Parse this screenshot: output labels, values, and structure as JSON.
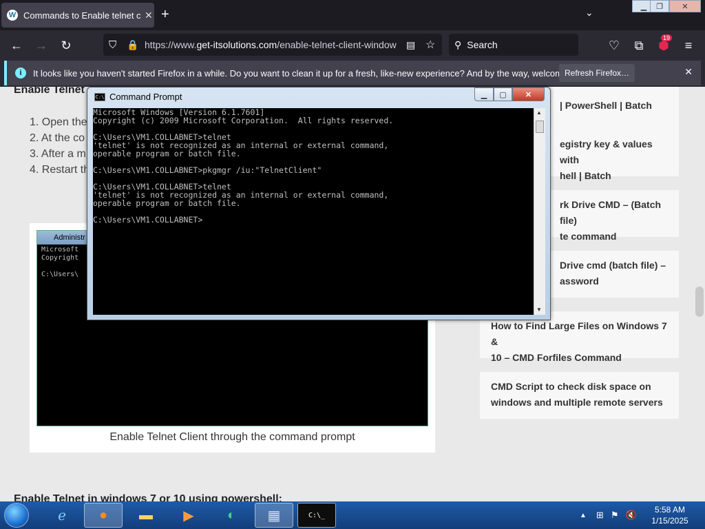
{
  "browser": {
    "tab": {
      "title": "Commands to Enable telnet cli",
      "favicon": "wordpress-icon"
    },
    "url": {
      "prefix": "https://www.",
      "domain": "get-itsolutions.com",
      "path": "/enable-telnet-client-window"
    },
    "search_placeholder": "Search",
    "extensions_badge": "19"
  },
  "notification": {
    "text": "It looks like you haven't started Firefox in a while. Do you want to clean it up for a fresh, like-new experience? And by the way, welcome back!",
    "button": "Refresh Firefox…"
  },
  "page": {
    "heading": "Enable Telnet",
    "steps": [
      "1. Open the",
      "2. At the co",
      "3. After a m",
      "4. Restart th"
    ],
    "figure": {
      "inner_title": "Administr",
      "inner_lines": [
        "Microsoft",
        "Copyright",
        "",
        "C:\\Users\\"
      ],
      "caption": "Enable Telnet Client through the command prompt"
    },
    "bottom_heading": "Enable Telnet in windows 7 or 10 using powershell:",
    "sidebar": [
      {
        "line1": "| PowerShell | Batch",
        "line2": ""
      },
      {
        "line1": "egistry key & values with",
        "line2": "hell | Batch"
      },
      {
        "line1": "rk Drive CMD – (Batch file)",
        "line2": "te command"
      },
      {
        "line1": "Drive cmd (batch file) –",
        "line2": "assword"
      },
      {
        "line1": "How to Find Large Files on Windows 7 &",
        "line2": "10 – CMD Forfiles Command"
      },
      {
        "line1": "CMD Script to check disk space on",
        "line2": "windows and multiple remote servers"
      }
    ]
  },
  "cmd": {
    "title": "Command Prompt",
    "output": "Microsoft Windows [Version 6.1.7601]\nCopyright (c) 2009 Microsoft Corporation.  All rights reserved.\n\nC:\\Users\\VM1.COLLABNET>telnet\n'telnet' is not recognized as an internal or external command,\noperable program or batch file.\n\nC:\\Users\\VM1.COLLABNET>pkgmgr /iu:\"TelnetClient\"\n\nC:\\Users\\VM1.COLLABNET>telnet\n'telnet' is not recognized as an internal or external command,\noperable program or batch file.\n\nC:\\Users\\VM1.COLLABNET>"
  },
  "taskbar": {
    "time": "5:58 AM",
    "date": "1/15/2025",
    "items": [
      "internet-explorer-icon",
      "firefox-icon",
      "file-explorer-icon",
      "media-player-icon",
      "browser-icon",
      "control-panel-icon",
      "command-prompt-icon"
    ]
  },
  "colors": {
    "firefox_dark": "#2b2a33",
    "info_accent": "#80ebff",
    "taskbar": "#1f5aa8"
  }
}
